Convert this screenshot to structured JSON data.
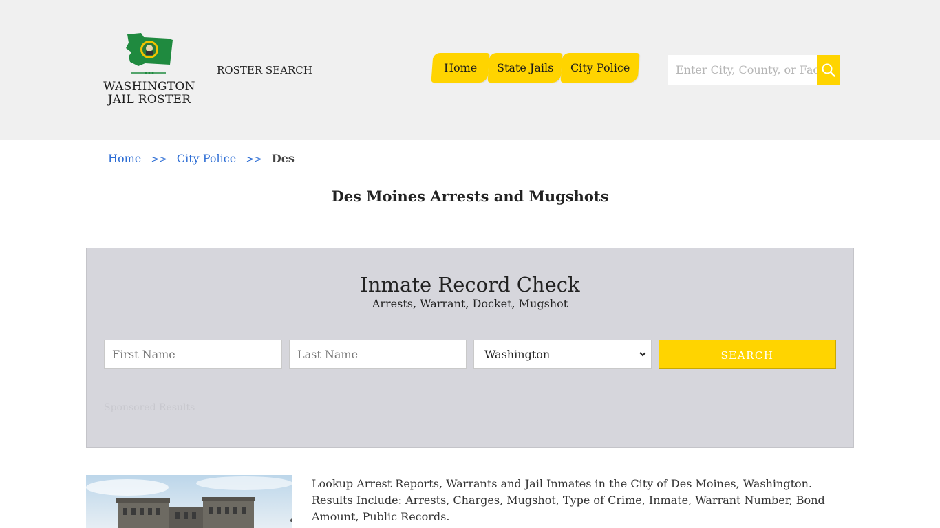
{
  "header": {
    "logo": {
      "line1": "WASHINGTON",
      "line2": "JAIL ROSTER"
    },
    "roster_search": "ROSTER SEARCH",
    "nav": [
      {
        "label": "Home"
      },
      {
        "label": "State Jails"
      },
      {
        "label": "City Police"
      }
    ],
    "search": {
      "placeholder": "Enter City, County, or Facility",
      "icon": "search-icon"
    },
    "colors": {
      "accent": "#ffd400",
      "background": "#f0f0f0"
    }
  },
  "breadcrumb": {
    "items": [
      {
        "label": "Home"
      },
      {
        "label": "City Police"
      }
    ],
    "separator": ">>",
    "current": "Des"
  },
  "page": {
    "title": "Des Moines Arrests and Mugshots"
  },
  "record_check": {
    "title": "Inmate Record Check",
    "subtitle": "Arrests, Warrant, Docket, Mugshot",
    "first_name_placeholder": "First Name",
    "last_name_placeholder": "Last Name",
    "state_selected": "Washington",
    "submit_label": "SEARCH",
    "sponsored": "Sponsored Results"
  },
  "content": {
    "description": "Lookup Arrest Reports, Warrants and Jail Inmates in the City of Des Moines, Washington. Results Include: Arrests, Charges, Mugshot, Type of Crime, Inmate, Warrant Number, Bond Amount, Public Records."
  }
}
